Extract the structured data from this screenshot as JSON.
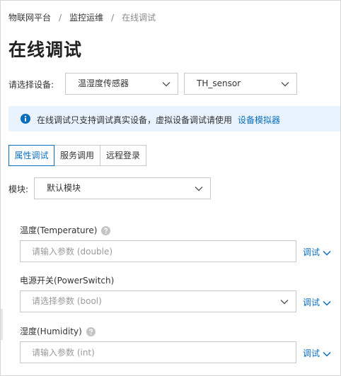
{
  "breadcrumb": {
    "items": [
      "物联网平台",
      "监控运维",
      "在线调试"
    ],
    "separator": "/"
  },
  "page": {
    "title": "在线调试"
  },
  "device": {
    "label": "请选择设备:",
    "product_value": "温湿度传感器",
    "device_value": "TH_sensor"
  },
  "notice": {
    "text": "在线调试只支持调试真实设备，虚拟设备调试请使用",
    "link": "设备模拟器"
  },
  "tabs": [
    {
      "label": "属性调试",
      "active": true
    },
    {
      "label": "服务调用",
      "active": false
    },
    {
      "label": "远程登录",
      "active": false
    }
  ],
  "module": {
    "label": "模块:",
    "value": "默认模块"
  },
  "properties": [
    {
      "label": "温度(Temperature)",
      "has_help": true,
      "control": "input",
      "placeholder": "请输入参数 (double)",
      "action": "调试"
    },
    {
      "label": "电源开关(PowerSwitch)",
      "has_help": false,
      "control": "select",
      "placeholder": "请选择参数 (bool)",
      "action": "调试"
    },
    {
      "label": "湿度(Humidity)",
      "has_help": true,
      "control": "input",
      "placeholder": "请输入参数 (int)",
      "action": "调试"
    }
  ],
  "colors": {
    "accent": "#0a6ebd",
    "notice_bg": "#e8f3fd",
    "border": "#c9c9c9",
    "placeholder": "#9a9a9a"
  },
  "icons": {
    "chevron": "chevron-down-icon",
    "info": "info-icon",
    "help": "help-icon"
  }
}
